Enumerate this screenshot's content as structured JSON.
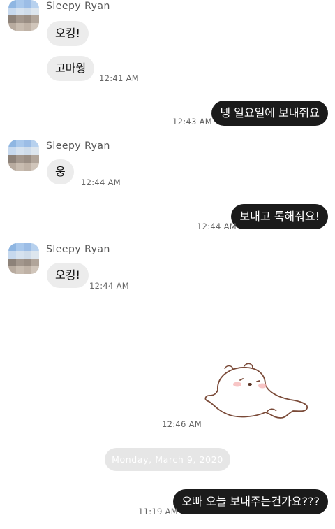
{
  "contact": {
    "name": "Sleepy Ryan"
  },
  "messages": [
    {
      "dir": "in",
      "text": "오킹!"
    },
    {
      "dir": "in",
      "text": "고마웡",
      "time": "12:41 AM"
    },
    {
      "dir": "out",
      "text": "넹 일요일에 보내줘요",
      "time": "12:43 AM"
    },
    {
      "dir": "in",
      "text": "웅",
      "time": "12:44 AM"
    },
    {
      "dir": "out",
      "text": "보내고 톡해줘요!",
      "time": "12:44 AM"
    },
    {
      "dir": "in",
      "text": "오킹!",
      "time": "12:44 AM"
    },
    {
      "dir": "out",
      "sticker": "sleepy-bear-lying-sticker",
      "time": "12:46 AM"
    },
    {
      "dir": "out",
      "text": "오빠 오늘 보내주는건가요???",
      "time": "11:19 AM"
    }
  ],
  "date_divider": "Monday, March 9, 2020",
  "colors": {
    "incoming_bubble": "#ececec",
    "outgoing_bubble": "#1b1b1b",
    "date_pill": "#e6e6e6"
  }
}
